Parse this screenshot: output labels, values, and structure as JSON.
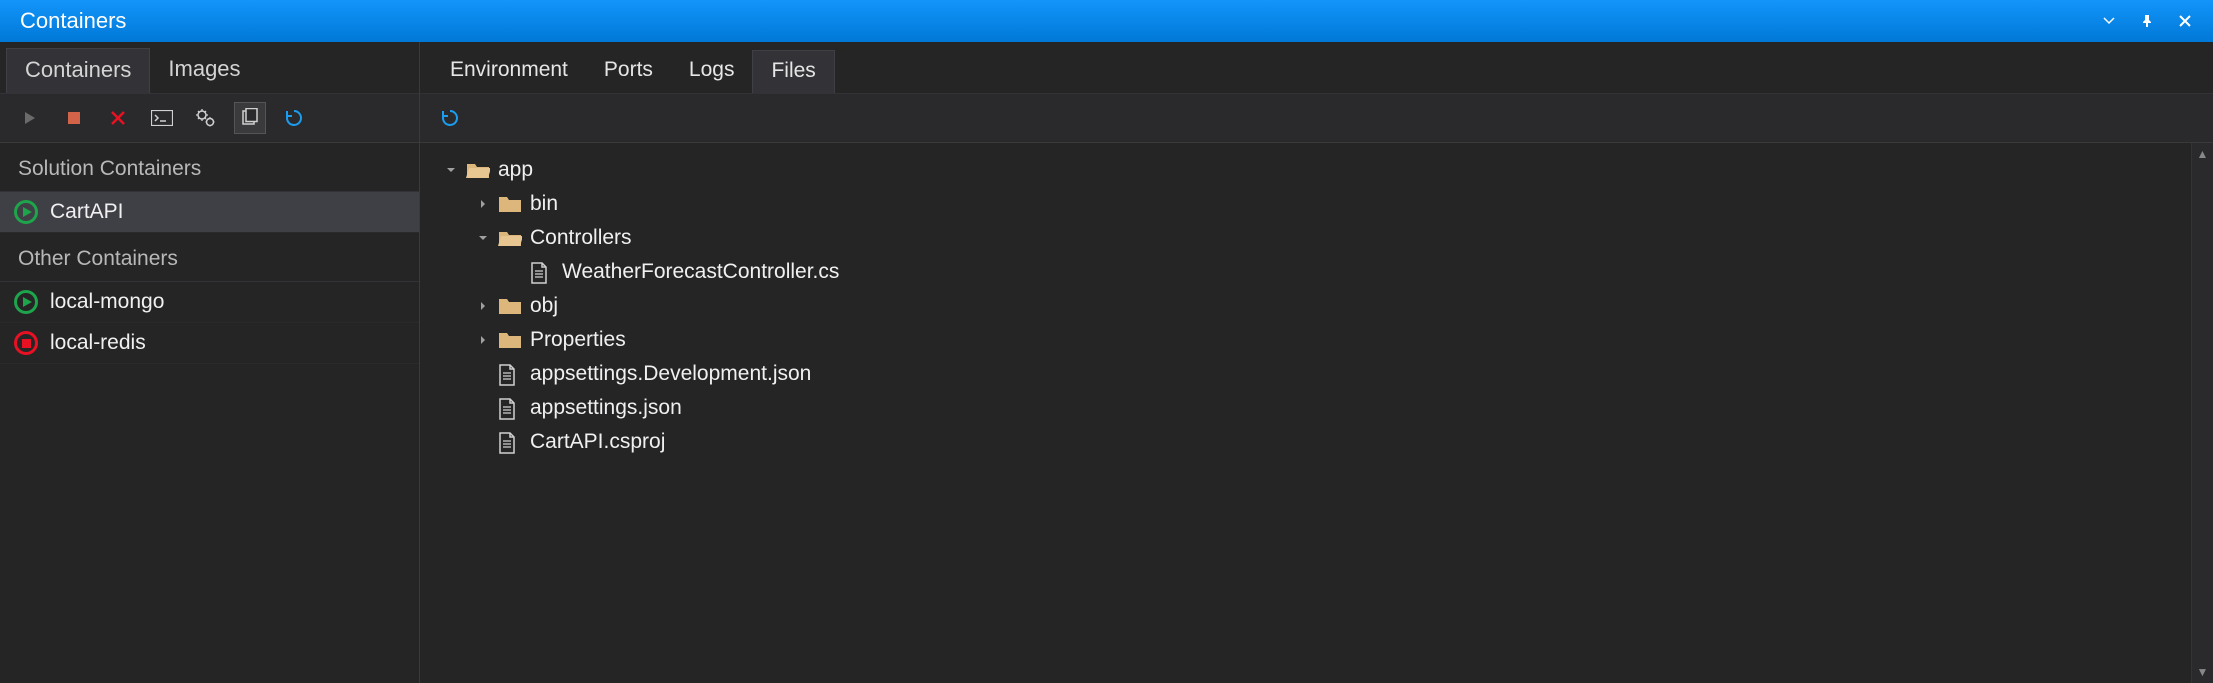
{
  "title": "Containers",
  "left_tabs": {
    "containers": "Containers",
    "images": "Images"
  },
  "sections": {
    "solution": "Solution Containers",
    "other": "Other Containers"
  },
  "solution_containers": [
    {
      "name": "CartAPI",
      "status": "running",
      "selected": true
    }
  ],
  "other_containers": [
    {
      "name": "local-mongo",
      "status": "running",
      "selected": false
    },
    {
      "name": "local-redis",
      "status": "stopped",
      "selected": false
    }
  ],
  "right_tabs": {
    "environment": "Environment",
    "ports": "Ports",
    "logs": "Logs",
    "files": "Files"
  },
  "tree": {
    "app": "app",
    "bin": "bin",
    "controllers": "Controllers",
    "weather": "WeatherForecastController.cs",
    "obj": "obj",
    "properties": "Properties",
    "appsettings_dev": "appsettings.Development.json",
    "appsettings": "appsettings.json",
    "csproj": "CartAPI.csproj"
  }
}
